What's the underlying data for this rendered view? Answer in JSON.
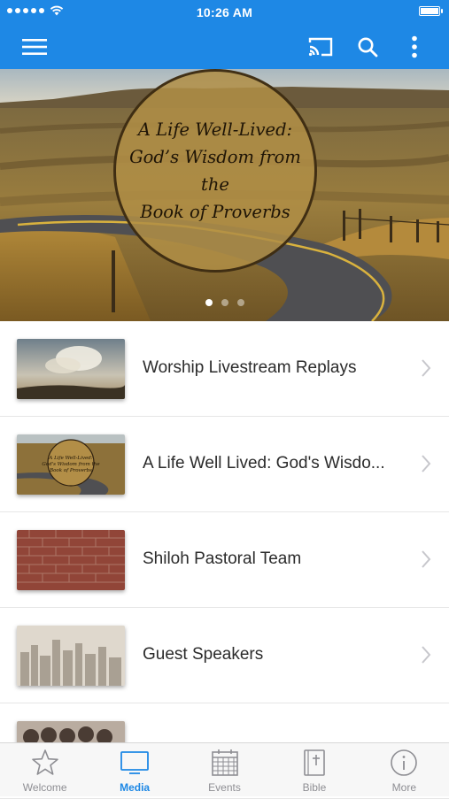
{
  "status_bar": {
    "time": "10:26 AM"
  },
  "hero": {
    "title_lines": [
      "A Life Well-Lived:",
      "God’s Wisdom from the",
      "Book of Proverbs"
    ],
    "page_count": 3,
    "active_page": 1
  },
  "list": [
    {
      "title": "Worship Livestream Replays",
      "thumb": "sky"
    },
    {
      "title": "A Life Well Lived: God's Wisdo...",
      "thumb": "road"
    },
    {
      "title": "Shiloh Pastoral Team",
      "thumb": "brick"
    },
    {
      "title": "Guest Speakers",
      "thumb": "city"
    },
    {
      "title": "",
      "thumb": "people"
    }
  ],
  "tabs": [
    {
      "label": "Welcome",
      "icon": "star-icon",
      "active": false
    },
    {
      "label": "Media",
      "icon": "tv-icon",
      "active": true
    },
    {
      "label": "Events",
      "icon": "calendar-icon",
      "active": false
    },
    {
      "label": "Bible",
      "icon": "bible-icon",
      "active": false
    },
    {
      "label": "More",
      "icon": "info-icon",
      "active": false
    }
  ],
  "colors": {
    "accent": "#1e88e5",
    "tab_inactive": "#8e8e93"
  }
}
